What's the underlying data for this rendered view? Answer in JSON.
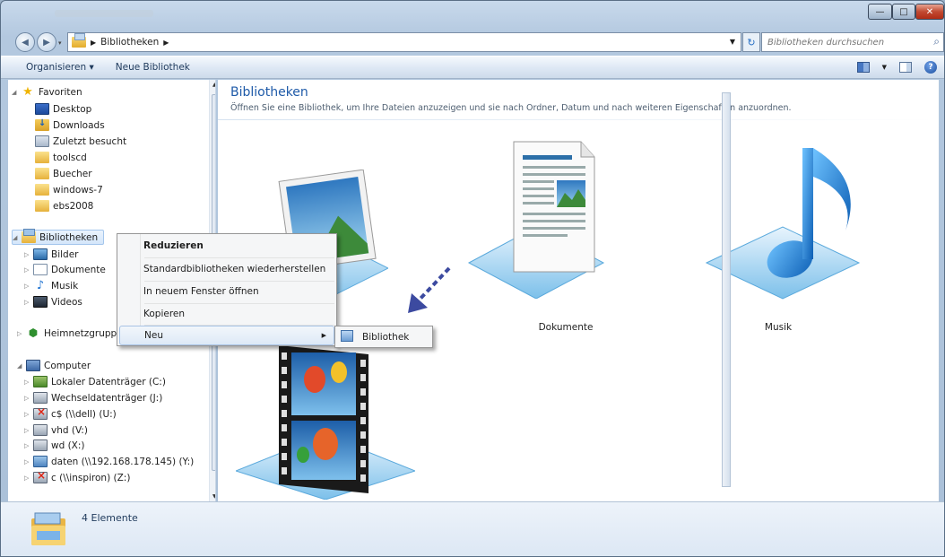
{
  "address": {
    "path": [
      "Bibliotheken"
    ],
    "search_placeholder": "Bibliotheken durchsuchen"
  },
  "toolbar": {
    "organize_label": "Organisieren",
    "new_library_label": "Neue Bibliothek"
  },
  "navpane": {
    "favorites": {
      "label": "Favoriten",
      "items": [
        "Desktop",
        "Downloads",
        "Zuletzt besucht",
        "toolscd",
        "Buecher",
        "windows-7",
        "ebs2008"
      ]
    },
    "libraries": {
      "label": "Bibliotheken",
      "items": [
        "Bilder",
        "Dokumente",
        "Musik",
        "Videos"
      ]
    },
    "homegroup": {
      "label": "Heimnetzgruppe"
    },
    "computer": {
      "label": "Computer",
      "items": [
        "Lokaler Datenträger (C:)",
        "Wechseldatenträger (J:)",
        "c$ (\\\\dell) (U:)",
        "vhd (V:)",
        "wd (X:)",
        "daten (\\\\192.168.178.145) (Y:)",
        "c (\\\\inspiron) (Z:)"
      ]
    }
  },
  "main": {
    "title": "Bibliotheken",
    "description": "Öffnen Sie eine Bibliothek, um Ihre Dateien anzuzeigen und sie nach Ordner, Datum und nach weiteren Eigenschaften anzuordnen.",
    "libraries": [
      {
        "label": "Dokumente",
        "icon": "documents-library-icon"
      },
      {
        "label": "Musik",
        "icon": "music-library-icon"
      }
    ]
  },
  "context_menu": {
    "items": [
      "Reduzieren",
      "Standardbibliotheken wiederherstellen",
      "In neuem Fenster öffnen",
      "Kopieren",
      "Neu"
    ],
    "submenu": {
      "item": "Bibliothek"
    }
  },
  "status": {
    "count_text": "4 Elemente"
  },
  "colors": {
    "accent": "#1e5aa8",
    "frame": "#aac0d8",
    "menu_hover": "#dde9f7"
  }
}
